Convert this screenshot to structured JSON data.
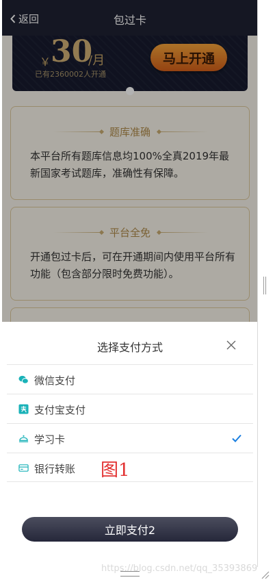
{
  "nav": {
    "back_label": "返回",
    "title": "包过卡"
  },
  "promo": {
    "currency": "￥",
    "price": "30",
    "unit": "/月",
    "users_text": "已有2360002人开通",
    "open_button": "马上开通"
  },
  "features": [
    {
      "title": "题库准确",
      "body": "本平台所有题库信息均100%全真2019年最新国家考试题库，准确性有保障。"
    },
    {
      "title": "平台全免",
      "body": "开通包过卡后，可在开通期间内使用平台所有功能（包含部分限时免费功能）。"
    }
  ],
  "payment": {
    "title": "选择支付方式",
    "options": [
      {
        "label": "微信支付",
        "icon": "wechat-icon",
        "selected": false
      },
      {
        "label": "支付宝支付",
        "icon": "alipay-icon",
        "selected": false
      },
      {
        "label": "学习卡",
        "icon": "study-card-icon",
        "selected": true
      },
      {
        "label": "银行转账",
        "icon": "bank-card-icon",
        "selected": false
      }
    ],
    "pay_button": "立即支付2"
  },
  "annotation": "图1",
  "watermark": "https://blog.csdn.net/qq_35393869",
  "colors": {
    "nav_bg": "#1f2233",
    "accent_gold": "#b08c4b",
    "check_blue": "#1a7fe0",
    "icon_teal": "#1ab2b8"
  }
}
